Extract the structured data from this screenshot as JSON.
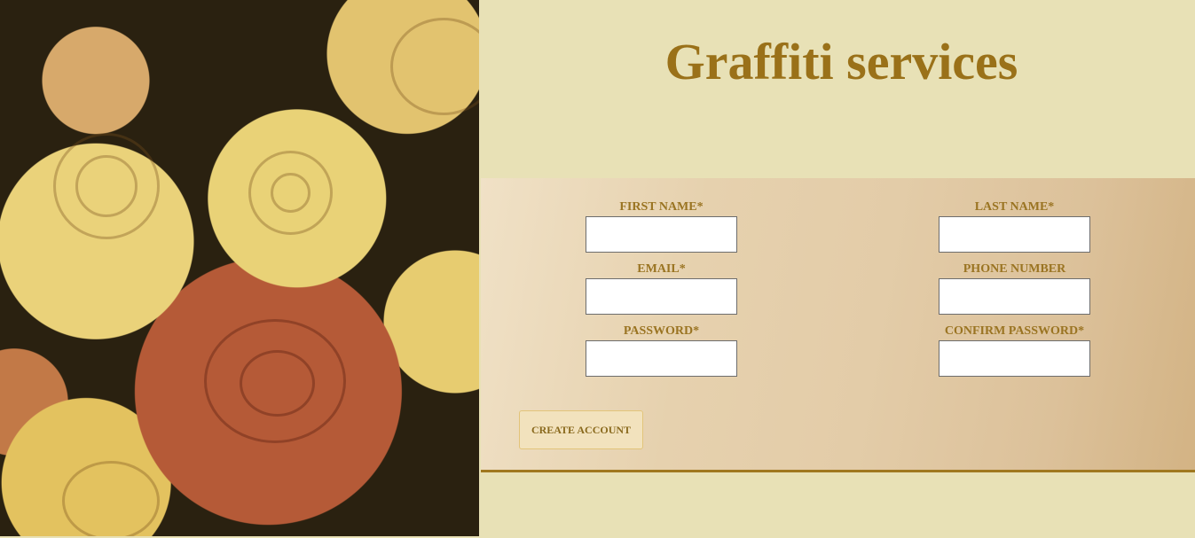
{
  "header": {
    "title": "Graffiti services"
  },
  "hero": {
    "image_subject": "roses"
  },
  "form": {
    "fields": {
      "first_name": {
        "label": "FIRST NAME*",
        "value": "",
        "placeholder": ""
      },
      "last_name": {
        "label": "LAST NAME*",
        "value": "",
        "placeholder": ""
      },
      "email": {
        "label": "EMAIL*",
        "value": "",
        "placeholder": ""
      },
      "phone": {
        "label": "PHONE NUMBER",
        "value": "",
        "placeholder": ""
      },
      "password": {
        "label": "PASSWORD*",
        "value": "",
        "placeholder": ""
      },
      "confirm_password": {
        "label": "CONFIRM PASSWORD*",
        "value": "",
        "placeholder": ""
      }
    },
    "submit_label": "CREATE ACCOUNT"
  },
  "colors": {
    "accent": "#9a7119",
    "background": "#e8e1b6",
    "button_bg": "#f2e2bd"
  }
}
